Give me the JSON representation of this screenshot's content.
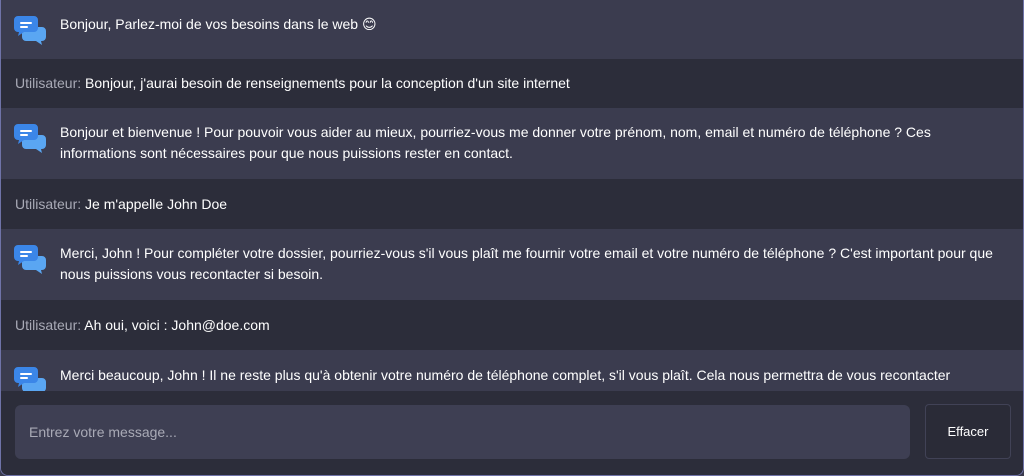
{
  "conversation": {
    "messages": [
      {
        "role": "bot",
        "text": "Bonjour, Parlez-moi de vos besoins dans le web 😊"
      },
      {
        "role": "user",
        "prefix": "Utilisateur:",
        "text": " Bonjour, j'aurai besoin de renseignements pour la conception d'un site internet"
      },
      {
        "role": "bot",
        "text": "Bonjour et bienvenue ! Pour pouvoir vous aider au mieux, pourriez-vous me donner votre prénom, nom, email et numéro de téléphone ? Ces informations sont nécessaires pour que nous puissions rester en contact."
      },
      {
        "role": "user",
        "prefix": "Utilisateur:",
        "text": " Je m'appelle John Doe"
      },
      {
        "role": "bot",
        "text": "Merci, John ! Pour compléter votre dossier, pourriez-vous s'il vous plaît me fournir votre email et votre numéro de téléphone ? C'est important pour que nous puissions vous recontacter si besoin."
      },
      {
        "role": "user",
        "prefix": "Utilisateur:",
        "text": " Ah oui, voici : John@doe.com"
      },
      {
        "role": "bot",
        "text": "Merci beaucoup, John ! Il ne reste plus qu'à obtenir votre numéro de téléphone complet, s'il vous plaît. Cela nous permettra de vous recontacter"
      }
    ]
  },
  "composer": {
    "input_value": "",
    "placeholder": "Entrez votre message...",
    "clear_label": "Effacer"
  },
  "icons": {
    "bot_avatar": "chat-bubbles-icon"
  },
  "colors": {
    "bot_row": "#3b3c4f",
    "user_row": "#2c2d3a",
    "avatar_front": "#3b86e8",
    "avatar_back": "#5aa6f2",
    "input_bg": "#3e3f53"
  }
}
